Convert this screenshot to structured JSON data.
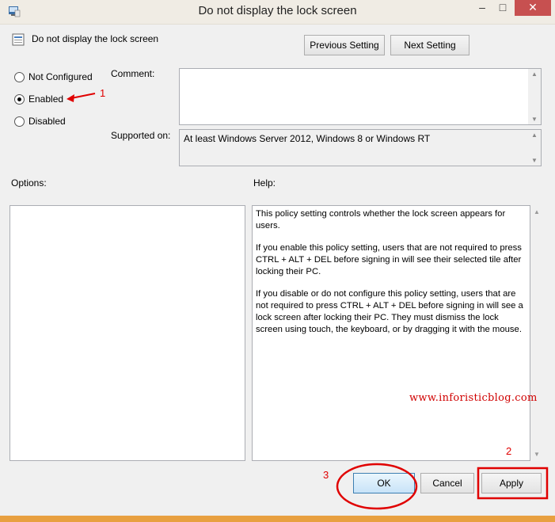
{
  "window": {
    "title": "Do not display the lock screen",
    "controls": {
      "minimize": "–",
      "maximize": "□",
      "close": "✕"
    }
  },
  "header": {
    "policy_name": "Do not display the lock screen",
    "previous_label": "Previous Setting",
    "next_label": "Next Setting"
  },
  "state": {
    "options": [
      {
        "label": "Not Configured",
        "checked": false
      },
      {
        "label": "Enabled",
        "checked": true
      },
      {
        "label": "Disabled",
        "checked": false
      }
    ]
  },
  "comment": {
    "label": "Comment:",
    "value": ""
  },
  "supported": {
    "label": "Supported on:",
    "value": "At least Windows Server 2012, Windows 8 or Windows RT"
  },
  "options_panel": {
    "label": "Options:"
  },
  "help_panel": {
    "label": "Help:",
    "paragraphs": [
      "This policy setting controls whether the lock screen appears for users.",
      "If you enable this policy setting, users that are not required to press CTRL + ALT + DEL before signing in will see their selected tile after  locking their PC.",
      "If you disable or do not configure this policy setting, users that are not required to press CTRL + ALT + DEL before signing in will see a lock screen after locking their PC. They must dismiss the lock screen using touch, the keyboard, or by dragging it with the mouse."
    ]
  },
  "footer": {
    "ok_label": "OK",
    "cancel_label": "Cancel",
    "apply_label": "Apply"
  },
  "annotations": {
    "step1": "1",
    "step2": "2",
    "step3": "3",
    "watermark": "www.inforisticblog.com",
    "color": "#e00000"
  }
}
